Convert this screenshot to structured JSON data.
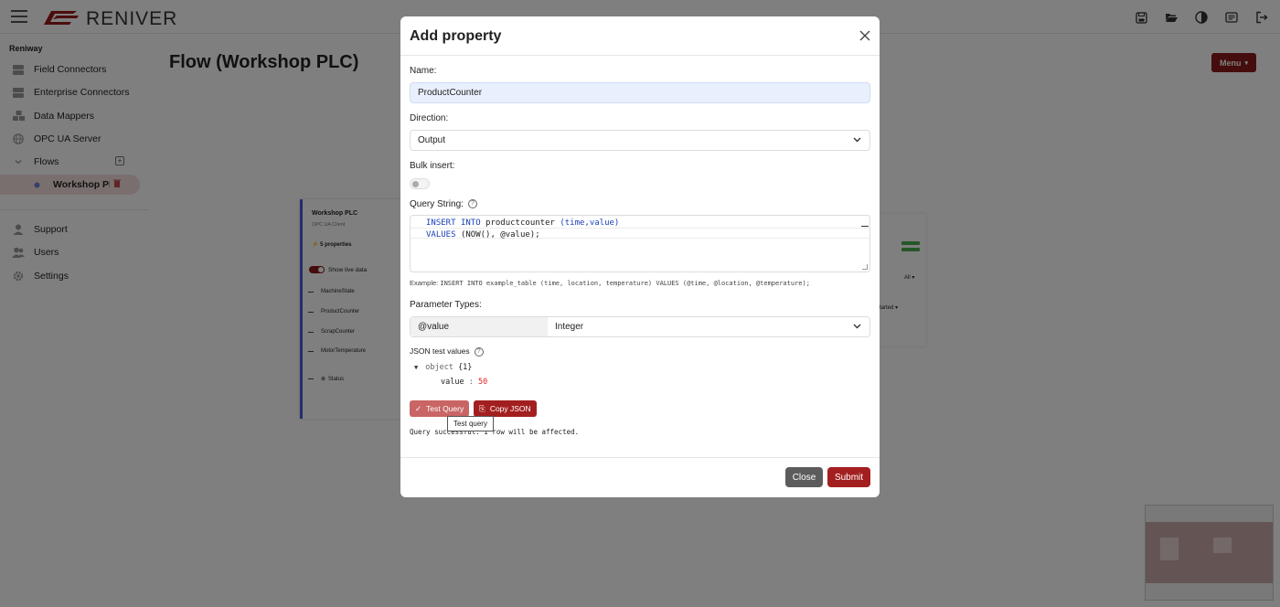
{
  "app": {
    "brand": "RENIVER",
    "accent_color": "#8b1a1a",
    "icons": [
      "save-icon",
      "folder-open-icon",
      "contrast-icon",
      "news-icon",
      "logout-icon"
    ]
  },
  "sidebar": {
    "section": "Reniway",
    "items": [
      {
        "label": "Field Connectors",
        "icon": "server-icon"
      },
      {
        "label": "Enterprise Connectors",
        "icon": "server-icon"
      },
      {
        "label": "Data Mappers",
        "icon": "cubes-icon"
      },
      {
        "label": "OPC UA Server",
        "icon": "globe-icon"
      },
      {
        "label": "Flows",
        "icon": "chevron-down-icon"
      },
      {
        "label": "Workshop PLC",
        "icon": "dot-icon"
      },
      {
        "label": "Support",
        "icon": "user-icon"
      },
      {
        "label": "Users",
        "icon": "users-icon"
      },
      {
        "label": "Settings",
        "icon": "gear-icon"
      }
    ]
  },
  "main": {
    "title": "Flow (Workshop PLC)",
    "menu_label": "Menu",
    "node": {
      "title": "Workshop PLC",
      "subtitle": "OPC UA Client",
      "badge": "5 properties",
      "live_label": "Show live data",
      "props": [
        "MachineState",
        "ProductCounter",
        "ScrapCounter",
        "MotorTemperature",
        "Status"
      ]
    },
    "node2": {
      "filter": "All",
      "status": "Started"
    }
  },
  "modal": {
    "title": "Add property",
    "name_label": "Name:",
    "name_value": "ProductCounter",
    "direction_label": "Direction:",
    "direction_value": "Output",
    "bulk_label": "Bulk insert:",
    "bulk_insert": false,
    "query_label": "Query String:",
    "query_line1_kw1": "INSERT",
    "query_line1_kw2": "INTO",
    "query_line1_table": "productcounter",
    "query_line1_cols": "(time,value)",
    "query_line2_kw": "VALUES",
    "query_line2_rest": "(NOW(), @value);",
    "example_label": "Example:",
    "example_query": "INSERT INTO example_table (time, location, temperature) VALUES (@time, @location, @temperature);",
    "param_label": "Parameter Types:",
    "param_name": "@value",
    "param_type": "Integer",
    "json_label": "JSON test values",
    "json_root_key": "object",
    "json_root_count": "{1}",
    "json_key": "value",
    "json_sep": ":",
    "json_value": "50",
    "btn_test": "Test Query",
    "btn_copy": "Copy JSON",
    "tooltip": "Test query",
    "result": "Query successful. 1 row will be affected.",
    "btn_close": "Close",
    "btn_submit": "Submit"
  }
}
